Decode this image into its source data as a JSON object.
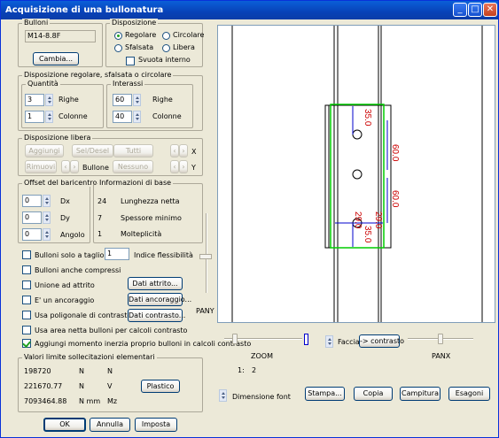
{
  "window": {
    "title": "Acquisizione di una bullonatura",
    "minimize": "_",
    "maximize": "□",
    "close": "✕"
  },
  "bulloni": {
    "label": "Bulloni",
    "value": "M14-8.8F",
    "cambia": "Cambia..."
  },
  "disposizione": {
    "label": "Disposizione",
    "regolare": "Regolare",
    "circolare": "Circolare",
    "sfalsata": "Sfalsata",
    "libera": "Libera",
    "svuota": "Svuota interno",
    "selected": "Regolare"
  },
  "regolare": {
    "label": "Disposizione regolare, sfalsata o circolare",
    "quantita": "Quantità",
    "interassi": "Interassi",
    "q_righe": "3",
    "q_colonne": "1",
    "i_righe": "60",
    "i_colonne": "40",
    "righe": "Righe",
    "colonne": "Colonne"
  },
  "libera": {
    "label": "Disposizione libera",
    "aggiungi": "Aggiungi",
    "seldesel": "Sel/Desel",
    "tutti": "Tutti",
    "rimuovi": "Rimuovi",
    "bullone": "Bullone",
    "nessuno": "Nessuno",
    "x": "X",
    "y": "Y"
  },
  "offset": {
    "label": "Offset del baricentro",
    "dx_val": "0",
    "dy_val": "0",
    "angolo_val": "0",
    "dx": "Dx",
    "dy": "Dy",
    "angolo": "Angolo"
  },
  "info": {
    "label": "Informazioni di base",
    "v1": "24",
    "l1": "Lunghezza netta",
    "v2": "7",
    "l2": "Spessore minimo",
    "v3": "1",
    "l3": "Molteplicità"
  },
  "options": {
    "solo_taglio": "Bulloni solo a taglio",
    "flex_val": "1",
    "flex_label": "Indice flessibilità",
    "anche_compressi": "Bulloni anche compressi",
    "unione_attrito": "Unione ad attrito",
    "dati_attrito": "Dati attrito...",
    "ancoraggio": "E' un ancoraggio",
    "dati_ancoraggio": "Dati ancoraggio...",
    "poligonale": "Usa poligonale di contrasto",
    "dati_contrasto": "Dati contrasto...",
    "area_netta": "Usa area netta bulloni per calcoli contrasto",
    "momento": "Aggiungi  momento inerzia proprio bulloni in calcoli contrasto"
  },
  "limiti": {
    "label": "Valori limite sollecitazioni elementari",
    "r1_val": "198720",
    "r1_u": "N",
    "r1_s": "N",
    "r2_val": "221670.77",
    "r2_u": "N",
    "r2_s": "V",
    "r3_val": "7093464.88",
    "r3_u": "N mm",
    "r3_s": "Mz",
    "plastico": "Plastico"
  },
  "footer": {
    "ok": "OK",
    "annulla": "Annulla",
    "imposta": "Imposta"
  },
  "drawing": {
    "dims": [
      "35.0",
      "60.0",
      "60.0",
      "29.0",
      "35.0",
      "29.0"
    ],
    "colors": {
      "dim": "#CC0000",
      "plate": "#00CC00",
      "arrow": "#0000CC"
    }
  },
  "controls": {
    "pany": "PANY",
    "zoom": "ZOOM",
    "zoom_ratio": "1:",
    "zoom_val": "2",
    "faccia": "Faccia",
    "contrasto": "-> contrasto",
    "panx": "PANX",
    "dimensione_font": "Dimensione font",
    "stampa": "Stampa...",
    "copia": "Copia",
    "campitura": "Campitura",
    "esagoni": "Esagoni"
  }
}
